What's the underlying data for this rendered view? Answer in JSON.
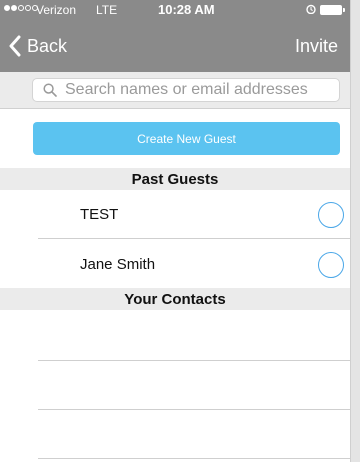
{
  "status": {
    "carrier": "Verizon",
    "network": "LTE",
    "time": "10:28 AM",
    "signal_bars": 2,
    "signal_total": 5
  },
  "nav": {
    "back_label": "Back",
    "action_label": "Invite"
  },
  "search": {
    "placeholder": "Search names or email addresses",
    "value": ""
  },
  "create_button": {
    "label": "Create New Guest"
  },
  "past_guests": {
    "title": "Past Guests",
    "items": [
      {
        "name": "TEST",
        "selected": false
      },
      {
        "name": "Jane Smith",
        "selected": false
      }
    ]
  },
  "contacts": {
    "title": "Your Contacts",
    "items": []
  },
  "colors": {
    "bar": "#8a8a8a",
    "accent": "#5bc3f0",
    "check": "#4aa7e8",
    "section_bg": "#ebebeb"
  }
}
